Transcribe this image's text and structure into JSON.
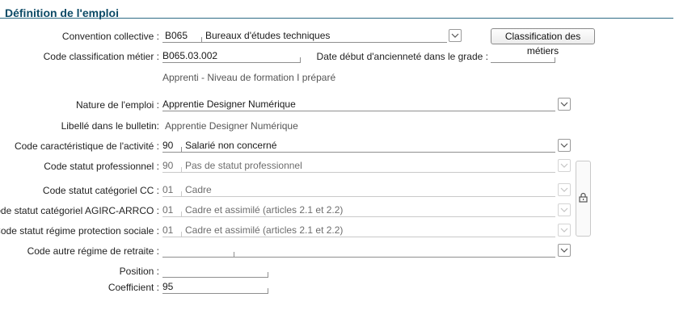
{
  "section": {
    "title": "Définition de l'emploi"
  },
  "convention": {
    "label": "Convention collective :",
    "code": "B065",
    "text": "Bureaux d'études techniques",
    "button": "Classification des métiers"
  },
  "classification": {
    "label": "Code classification métier :",
    "value": "B065.03.002",
    "description": "Apprenti - Niveau de formation I préparé"
  },
  "anciennete": {
    "label": "Date début d'ancienneté dans le grade :",
    "value": ""
  },
  "nature": {
    "label": "Nature de l'emploi :",
    "value": "Apprentie Designer Numérique"
  },
  "libelle": {
    "label": "Libellé dans le bulletin:",
    "value": "Apprentie Designer Numérique"
  },
  "activite": {
    "label": "Code caractéristique de l'activité :",
    "code": "90",
    "text": "Salarié non concerné"
  },
  "statut_pro": {
    "label": "Code statut professionnel :",
    "code": "90",
    "text": "Pas de statut professionnel"
  },
  "statut_cc": {
    "label": "Code statut catégoriel CC :",
    "code": "01",
    "text": "Cadre"
  },
  "statut_agirc": {
    "label": "Code statut catégoriel AGIRC-ARRCO :",
    "code": "01",
    "text": "Cadre et assimilé (articles 2.1 et 2.2)"
  },
  "statut_protection": {
    "label": "Code statut régime protection sociale :",
    "code": "01",
    "text": "Cadre et assimilé (articles 2.1 et 2.2)"
  },
  "autre_regime": {
    "label": "Code autre régime de retraite :",
    "code": "",
    "text": ""
  },
  "position": {
    "label": "Position :",
    "value": ""
  },
  "coefficient": {
    "label": "Coefficient :",
    "value": "95"
  },
  "icons": {
    "dropdown": "chevron-down-icon",
    "lock": "lock-icon"
  }
}
